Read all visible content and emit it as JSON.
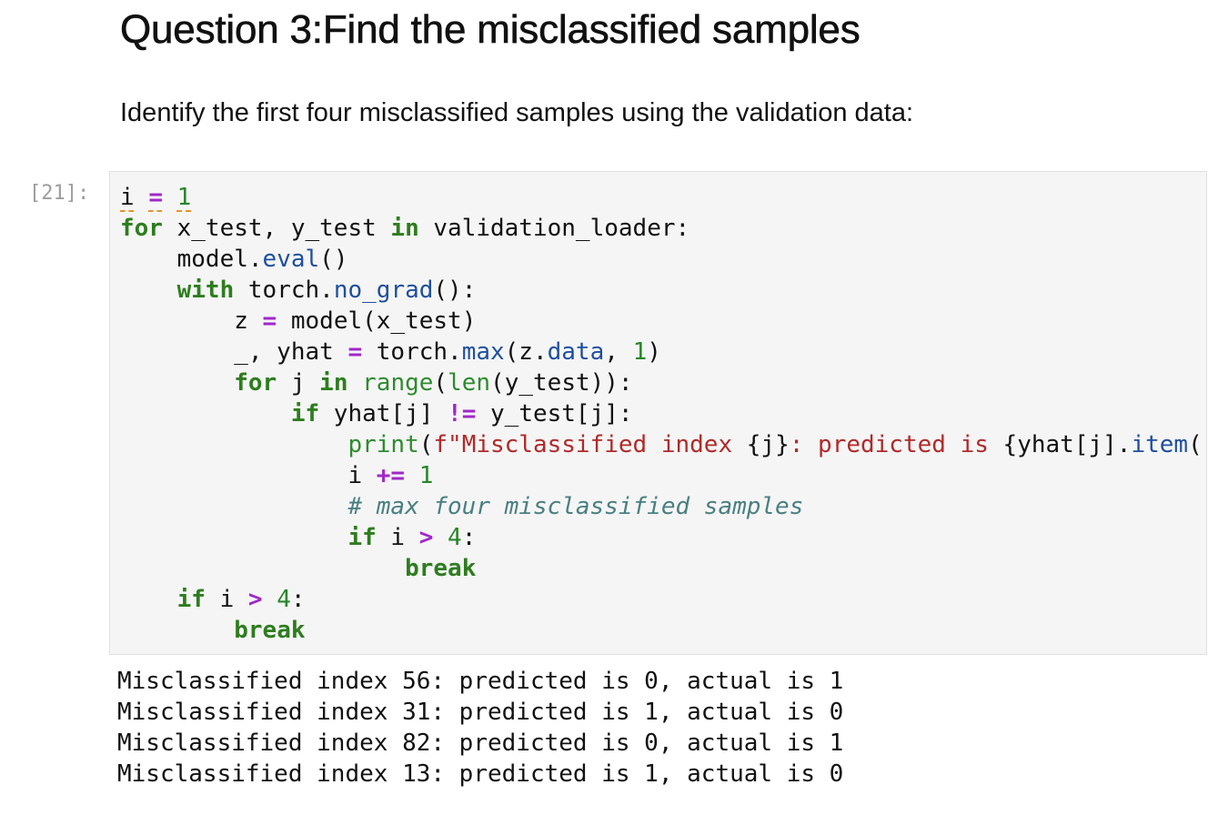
{
  "heading": "Question 3:Find the misclassified samples",
  "paragraph": "Identify the first four misclassified samples using the validation data:",
  "cell": {
    "prompt": "[21]:",
    "code_lines": [
      [
        {
          "t": "i",
          "c": "lint"
        },
        {
          "t": " "
        },
        {
          "t": "=",
          "c": "op lint"
        },
        {
          "t": " "
        },
        {
          "t": "1",
          "c": "num lint"
        }
      ],
      [
        {
          "t": "for",
          "c": "kw"
        },
        {
          "t": " x_test, y_test "
        },
        {
          "t": "in",
          "c": "kw"
        },
        {
          "t": " validation_loader:"
        }
      ],
      [
        {
          "t": "    model."
        },
        {
          "t": "eval",
          "c": "fn"
        },
        {
          "t": "()"
        }
      ],
      [
        {
          "t": "    "
        },
        {
          "t": "with",
          "c": "kw"
        },
        {
          "t": " torch."
        },
        {
          "t": "no_grad",
          "c": "fn"
        },
        {
          "t": "():"
        }
      ],
      [
        {
          "t": "        z "
        },
        {
          "t": "=",
          "c": "op"
        },
        {
          "t": " model(x_test)"
        }
      ],
      [
        {
          "t": "        _, yhat "
        },
        {
          "t": "=",
          "c": "op"
        },
        {
          "t": " torch."
        },
        {
          "t": "max",
          "c": "fn"
        },
        {
          "t": "(z."
        },
        {
          "t": "data",
          "c": "fn"
        },
        {
          "t": ", "
        },
        {
          "t": "1",
          "c": "num"
        },
        {
          "t": ")"
        }
      ],
      [
        {
          "t": "        "
        },
        {
          "t": "for",
          "c": "kw"
        },
        {
          "t": " j "
        },
        {
          "t": "in",
          "c": "kw"
        },
        {
          "t": " "
        },
        {
          "t": "range",
          "c": "bi"
        },
        {
          "t": "("
        },
        {
          "t": "len",
          "c": "bi"
        },
        {
          "t": "(y_test)):"
        }
      ],
      [
        {
          "t": "            "
        },
        {
          "t": "if",
          "c": "kw"
        },
        {
          "t": " yhat[j] "
        },
        {
          "t": "!=",
          "c": "op"
        },
        {
          "t": " y_test[j]:"
        }
      ],
      [
        {
          "t": "                "
        },
        {
          "t": "print",
          "c": "bi"
        },
        {
          "t": "("
        },
        {
          "t": "f\"Misclassified index ",
          "c": "str"
        },
        {
          "t": "{j}"
        },
        {
          "t": ": predicted is ",
          "c": "str"
        },
        {
          "t": "{yhat[j]."
        },
        {
          "t": "item",
          "c": "fn"
        },
        {
          "t": "()"
        }
      ],
      [
        {
          "t": "                i "
        },
        {
          "t": "+=",
          "c": "op"
        },
        {
          "t": " "
        },
        {
          "t": "1",
          "c": "num"
        }
      ],
      [
        {
          "t": "                "
        },
        {
          "t": "# max four misclassified samples",
          "c": "cm"
        }
      ],
      [
        {
          "t": "                "
        },
        {
          "t": "if",
          "c": "kw"
        },
        {
          "t": " i "
        },
        {
          "t": ">",
          "c": "op"
        },
        {
          "t": " "
        },
        {
          "t": "4",
          "c": "num"
        },
        {
          "t": ":"
        }
      ],
      [
        {
          "t": "                    "
        },
        {
          "t": "break",
          "c": "kw"
        }
      ],
      [
        {
          "t": "    "
        },
        {
          "t": "if",
          "c": "kw"
        },
        {
          "t": " i "
        },
        {
          "t": ">",
          "c": "op"
        },
        {
          "t": " "
        },
        {
          "t": "4",
          "c": "num"
        },
        {
          "t": ":"
        }
      ],
      [
        {
          "t": "        "
        },
        {
          "t": "break",
          "c": "kw"
        }
      ]
    ],
    "output_lines": [
      "Misclassified index 56: predicted is 0, actual is 1",
      "Misclassified index 31: predicted is 1, actual is 0",
      "Misclassified index 82: predicted is 0, actual is 1",
      "Misclassified index 13: predicted is 1, actual is 0"
    ]
  },
  "colors": {
    "keyword": "#2e7d1f",
    "operator": "#a127c9",
    "number": "#28862a",
    "attribute": "#1e4f9e",
    "string": "#b02a2a",
    "comment": "#4a7f82",
    "prompt": "#9e9e9e",
    "cell_background": "#f5f5f5"
  }
}
